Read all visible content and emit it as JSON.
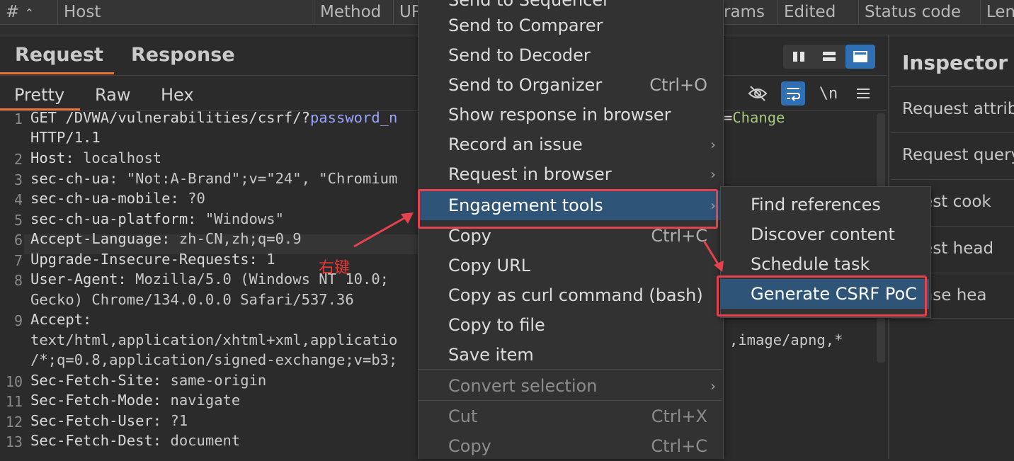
{
  "table_header": {
    "cols": [
      "#",
      "Host",
      "Method",
      "UR",
      "rams",
      "Edited",
      "Status code",
      "Len"
    ],
    "sort_glyph": "^"
  },
  "request_pane": {
    "tabs": [
      "Request",
      "Response"
    ],
    "subtabs": [
      "Pretty",
      "Raw",
      "Hex"
    ],
    "lines": [
      {
        "n": "1",
        "parts": [
          [
            "hk",
            "GET /DVWA/vulnerabilities/csrf/?"
          ],
          [
            "q",
            "password_n"
          ]
        ],
        "tail": [
          [
            "hk",
            "="
          ],
          [
            "grn",
            "Change"
          ]
        ]
      },
      {
        "n": "",
        "parts": [
          [
            "hk",
            "HTTP/1.1"
          ]
        ]
      },
      {
        "n": "2",
        "parts": [
          [
            "hk",
            "Host: "
          ],
          [
            "hv",
            "localhost"
          ]
        ]
      },
      {
        "n": "3",
        "parts": [
          [
            "hk",
            "sec-ch-ua: "
          ],
          [
            "hv",
            "\"Not:A-Brand\";v=\"24\", \"Chromium"
          ]
        ]
      },
      {
        "n": "4",
        "parts": [
          [
            "hk",
            "sec-ch-ua-mobile: "
          ],
          [
            "hv",
            "?0"
          ]
        ]
      },
      {
        "n": "5",
        "parts": [
          [
            "hk",
            "sec-ch-ua-platform: "
          ],
          [
            "hv",
            "\"Windows\""
          ]
        ]
      },
      {
        "n": "6",
        "parts": [
          [
            "hk",
            "Accept-Language: "
          ],
          [
            "hv",
            "zh-CN,zh;q=0.9"
          ]
        ]
      },
      {
        "n": "7",
        "parts": [
          [
            "hk",
            "Upgrade-Insecure-Requests: "
          ],
          [
            "hv",
            "1"
          ]
        ]
      },
      {
        "n": "8",
        "parts": [
          [
            "hk",
            "User-Agent: "
          ],
          [
            "hv",
            "Mozilla/5.0 (Windows NT 10.0;"
          ]
        ]
      },
      {
        "n": "",
        "parts": [
          [
            "hv",
            "Gecko) Chrome/134.0.0.0 Safari/537.36"
          ]
        ]
      },
      {
        "n": "9",
        "parts": [
          [
            "hk",
            "Accept:"
          ]
        ]
      },
      {
        "n": "",
        "parts": [
          [
            "hv",
            "text/html,application/xhtml+xml,applicatio"
          ]
        ],
        "tail": [
          [
            "hv",
            ",image/apng,*"
          ]
        ]
      },
      {
        "n": "",
        "parts": [
          [
            "hv",
            "/*;q=0.8,application/signed-exchange;v=b3;"
          ]
        ]
      },
      {
        "n": "10",
        "parts": [
          [
            "hk",
            "Sec-Fetch-Site: "
          ],
          [
            "hv",
            "same-origin"
          ]
        ]
      },
      {
        "n": "11",
        "parts": [
          [
            "hk",
            "Sec-Fetch-Mode: "
          ],
          [
            "hv",
            "navigate"
          ]
        ]
      },
      {
        "n": "12",
        "parts": [
          [
            "hk",
            "Sec-Fetch-User: "
          ],
          [
            "hv",
            "?1"
          ]
        ]
      },
      {
        "n": "13",
        "parts": [
          [
            "hk",
            "Sec-Fetch-Dest: "
          ],
          [
            "hv",
            "document"
          ]
        ]
      }
    ]
  },
  "inspector": {
    "title": "Inspector",
    "rows": [
      "Request attrib",
      "Request query",
      "quest cook",
      "quest head",
      "ponse hea"
    ]
  },
  "context_menu": {
    "top_partial": "Send to Sequencer",
    "items": [
      {
        "label": "Send to Comparer",
        "shortcut": "",
        "arrow": false,
        "disabled": false
      },
      {
        "label": "Send to Decoder",
        "shortcut": "",
        "arrow": false,
        "disabled": false
      },
      {
        "label": "Send to Organizer",
        "shortcut": "Ctrl+O",
        "arrow": false,
        "disabled": false
      },
      {
        "label": "Show response in browser",
        "shortcut": "",
        "arrow": false,
        "disabled": false
      },
      {
        "label": "Record an issue",
        "shortcut": "",
        "arrow": true,
        "disabled": false
      },
      {
        "label": "Request in browser",
        "shortcut": "",
        "arrow": true,
        "disabled": false
      },
      {
        "label": "Engagement tools",
        "shortcut": "",
        "arrow": true,
        "disabled": false,
        "highlighted": true
      },
      {
        "label": "Copy",
        "shortcut": "Ctrl+C",
        "arrow": false,
        "disabled": false
      },
      {
        "label": "Copy URL",
        "shortcut": "",
        "arrow": false,
        "disabled": false
      },
      {
        "label": "Copy as curl command (bash)",
        "shortcut": "",
        "arrow": false,
        "disabled": false
      },
      {
        "label": "Copy to file",
        "shortcut": "",
        "arrow": false,
        "disabled": false
      },
      {
        "label": "Save item",
        "shortcut": "",
        "arrow": false,
        "disabled": false
      },
      {
        "label": "Convert selection",
        "shortcut": "",
        "arrow": true,
        "disabled": true
      },
      {
        "label": "Cut",
        "shortcut": "Ctrl+X",
        "arrow": false,
        "disabled": true
      },
      {
        "label": "Copy",
        "shortcut": "Ctrl+C",
        "arrow": false,
        "disabled": true
      }
    ]
  },
  "submenu": {
    "items": [
      "Find references",
      "Discover content",
      "Schedule task",
      "Generate CSRF PoC"
    ]
  },
  "annotation": {
    "label": "右键"
  },
  "colors": {
    "accent": "#e8723a",
    "highlight": "#2e5478",
    "annotation": "#e4424d"
  }
}
